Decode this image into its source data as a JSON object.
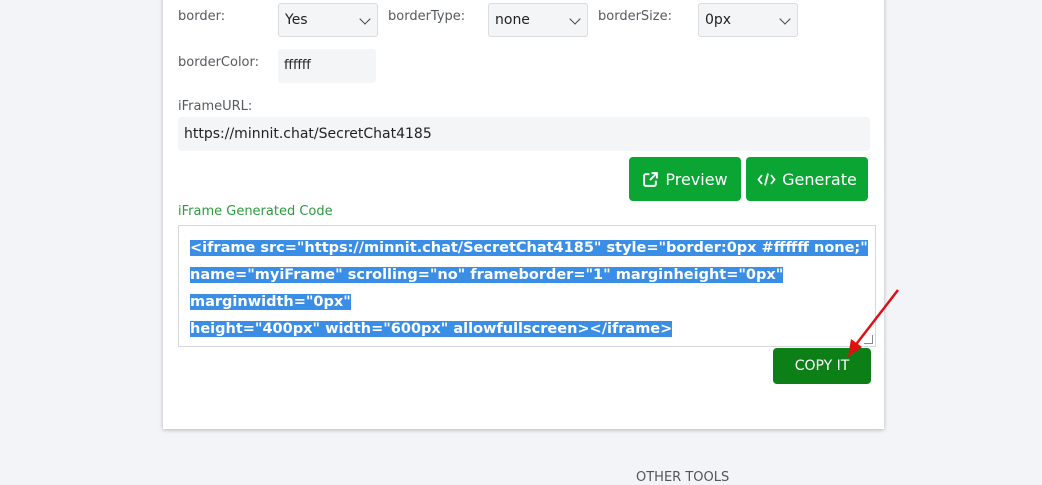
{
  "form": {
    "border_label": "border:",
    "border_value": "Yes",
    "borderType_label": "borderType:",
    "borderType_value": "none",
    "borderSize_label": "borderSize:",
    "borderSize_value": "0px",
    "borderColor_label": "borderColor:",
    "borderColor_value": "ffffff",
    "iframeURL_label": "iFrameURL:",
    "iframeURL_value": "https://minnit.chat/SecretChat4185"
  },
  "buttons": {
    "preview": "Preview",
    "generate": "Generate",
    "copy": "COPY IT"
  },
  "code": {
    "label": "iFrame Generated Code",
    "line1": "<iframe src=\"https://minnit.chat/SecretChat4185\" style=\"border:0px #ffffff none;\"",
    "line2": "name=\"myiFrame\" scrolling=\"no\" frameborder=\"1\" marginheight=\"0px\" marginwidth=\"0px\"",
    "line3": "height=\"400px\" width=\"600px\" allowfullscreen></iframe>"
  },
  "footer": {
    "other_tools": "OTHER TOOLS"
  },
  "colors": {
    "accent_green": "#0aa532",
    "copy_green": "#0c7f17",
    "selection_blue": "#3a8ee6",
    "annotation_red": "#e01010"
  },
  "icons": {
    "preview": "external-link-icon",
    "generate": "code-icon",
    "select": "chevron-down-icon",
    "annotation": "red-arrow-icon"
  }
}
